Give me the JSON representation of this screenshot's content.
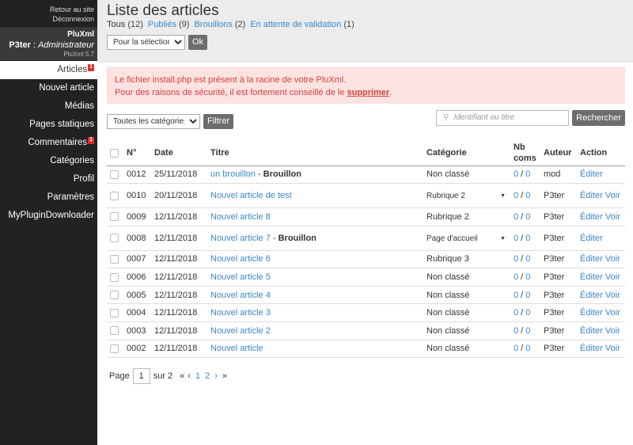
{
  "sidebar": {
    "back_link": "Retour au site",
    "logout_link": "Déconnexion",
    "site_name": "PluXml",
    "user_name": "P3ter",
    "user_sep": " : ",
    "user_role": "Administrateur",
    "version": "PluXml 5.7",
    "items": [
      {
        "label": "Articles",
        "badge": "1",
        "active": true
      },
      {
        "label": "Nouvel article"
      },
      {
        "label": "Médias"
      },
      {
        "label": "Pages statiques"
      },
      {
        "label": "Commentaires",
        "badge": "1"
      },
      {
        "label": "Catégories"
      },
      {
        "label": "Profil"
      },
      {
        "label": "Paramètres"
      },
      {
        "label": "MyPluginDownloader"
      }
    ]
  },
  "header": {
    "title": "Liste des articles",
    "filters": [
      {
        "label": "Tous",
        "count": "(12)",
        "link": false
      },
      {
        "label": "Publiés",
        "count": "(9)",
        "link": true
      },
      {
        "label": "Brouillons",
        "count": "(2)",
        "link": true
      },
      {
        "label": "En attente de validation",
        "count": "(1)",
        "link": true
      }
    ],
    "selection_value": "Pour la sélection...",
    "ok_label": "Ok"
  },
  "alert": {
    "line1": "Le fichier install.php est présent à la racine de votre PluXml.",
    "line2_prefix": "Pour des raisons de sécurité, il est fortement conseillé de le ",
    "line2_link": "supprimer",
    "line2_suffix": "."
  },
  "tools": {
    "category_filter_value": "Toutes les catégories...",
    "filter_label": "Filtrer",
    "search_placeholder": "Identifiant ou titre",
    "search_label": "Rechercher"
  },
  "table": {
    "headers": {
      "num": "N°",
      "date": "Date",
      "title": "Titre",
      "category": "Catégorie",
      "coms_line1": "Nb",
      "coms_line2": "coms",
      "author": "Auteur",
      "action": "Action"
    },
    "rows": [
      {
        "num": "0012",
        "date": "25/11/2018",
        "title": "un brouillon",
        "status": "Brouillon",
        "category": "Non classé",
        "cat_select": false,
        "coms_a": "0",
        "coms_b": "0",
        "author": "mod",
        "edit": "Éditer",
        "view": ""
      },
      {
        "num": "0010",
        "date": "20/11/2018",
        "title": "Nouvel article de test",
        "status": "",
        "category": "Rubrique 2",
        "cat_select": true,
        "coms_a": "0",
        "coms_b": "0",
        "author": "P3ter",
        "edit": "Éditer",
        "view": "Voir"
      },
      {
        "num": "0009",
        "date": "12/11/2018",
        "title": "Nouvel article 8",
        "status": "",
        "category": "Rubrique 2",
        "cat_select": false,
        "coms_a": "0",
        "coms_b": "0",
        "author": "P3ter",
        "edit": "Éditer",
        "view": "Voir"
      },
      {
        "num": "0008",
        "date": "12/11/2018",
        "title": "Nouvel article 7",
        "status": "Brouillon",
        "category": "Page d'accueil",
        "cat_select": true,
        "coms_a": "0",
        "coms_b": "0",
        "author": "P3ter",
        "edit": "Éditer",
        "view": ""
      },
      {
        "num": "0007",
        "date": "12/11/2018",
        "title": "Nouvel article 6",
        "status": "",
        "category": "Rubrique 3",
        "cat_select": false,
        "coms_a": "0",
        "coms_b": "0",
        "author": "P3ter",
        "edit": "Éditer",
        "view": "Voir"
      },
      {
        "num": "0006",
        "date": "12/11/2018",
        "title": "Nouvel article 5",
        "status": "",
        "category": "Non classé",
        "cat_select": false,
        "coms_a": "0",
        "coms_b": "0",
        "author": "P3ter",
        "edit": "Éditer",
        "view": "Voir"
      },
      {
        "num": "0005",
        "date": "12/11/2018",
        "title": "Nouvel article 4",
        "status": "",
        "category": "Non classé",
        "cat_select": false,
        "coms_a": "0",
        "coms_b": "0",
        "author": "P3ter",
        "edit": "Éditer",
        "view": "Voir"
      },
      {
        "num": "0004",
        "date": "12/11/2018",
        "title": "Nouvel article 3",
        "status": "",
        "category": "Non classé",
        "cat_select": false,
        "coms_a": "0",
        "coms_b": "0",
        "author": "P3ter",
        "edit": "Éditer",
        "view": "Voir"
      },
      {
        "num": "0003",
        "date": "12/11/2018",
        "title": "Nouvel article 2",
        "status": "",
        "category": "Non classé",
        "cat_select": false,
        "coms_a": "0",
        "coms_b": "0",
        "author": "P3ter",
        "edit": "Éditer",
        "view": "Voir"
      },
      {
        "num": "0002",
        "date": "12/11/2018",
        "title": "Nouvel article",
        "status": "",
        "category": "Non classé",
        "cat_select": false,
        "coms_a": "0",
        "coms_b": "0",
        "author": "P3ter",
        "edit": "Éditer",
        "view": "Voir"
      }
    ]
  },
  "pager": {
    "page_label": "Page",
    "current": "1",
    "of_label": "sur 2",
    "first": "«",
    "prev": "‹",
    "pages": [
      "1",
      "2"
    ],
    "next": "›",
    "last": "»"
  },
  "colors": {
    "link": "#3a87c8",
    "alert_bg": "#fde2e2",
    "alert_text": "#d3423b",
    "sidebar_bg": "#222222",
    "badge": "#e02d2d"
  }
}
